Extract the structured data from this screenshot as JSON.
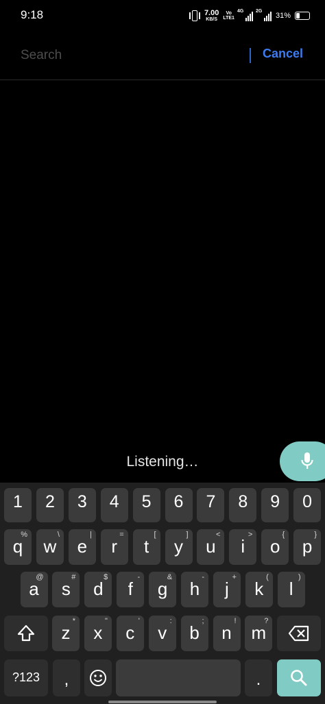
{
  "status_bar": {
    "time": "9:18",
    "net_speed_value": "7.00",
    "net_speed_unit": "KB/S",
    "volte_top": "Vo",
    "volte_bottom": "LTE1",
    "sig1_label": "4G",
    "sig2_label": "2G",
    "battery_pct": "31%",
    "battery_level": 0.31
  },
  "search": {
    "placeholder": "Search",
    "value": "",
    "cancel_label": "Cancel"
  },
  "voice": {
    "status": "Listening…"
  },
  "keyboard": {
    "numbers": [
      "1",
      "2",
      "3",
      "4",
      "5",
      "6",
      "7",
      "8",
      "9",
      "0"
    ],
    "row1": [
      {
        "key": "q",
        "hint": "%"
      },
      {
        "key": "w",
        "hint": "\\"
      },
      {
        "key": "e",
        "hint": "|"
      },
      {
        "key": "r",
        "hint": "="
      },
      {
        "key": "t",
        "hint": "["
      },
      {
        "key": "y",
        "hint": "]"
      },
      {
        "key": "u",
        "hint": "<"
      },
      {
        "key": "i",
        "hint": ">"
      },
      {
        "key": "o",
        "hint": "{"
      },
      {
        "key": "p",
        "hint": "}"
      }
    ],
    "row2": [
      {
        "key": "a",
        "hint": "@"
      },
      {
        "key": "s",
        "hint": "#"
      },
      {
        "key": "d",
        "hint": "$"
      },
      {
        "key": "f",
        "hint": "-"
      },
      {
        "key": "g",
        "hint": "&"
      },
      {
        "key": "h",
        "hint": "-"
      },
      {
        "key": "j",
        "hint": "+"
      },
      {
        "key": "k",
        "hint": "("
      },
      {
        "key": "l",
        "hint": ")"
      }
    ],
    "row3": [
      {
        "key": "z",
        "hint": "*"
      },
      {
        "key": "x",
        "hint": "\""
      },
      {
        "key": "c",
        "hint": "'"
      },
      {
        "key": "v",
        "hint": ":"
      },
      {
        "key": "b",
        "hint": ";"
      },
      {
        "key": "n",
        "hint": "!"
      },
      {
        "key": "m",
        "hint": "?"
      }
    ],
    "symbols_label": "?123",
    "comma_label": ",",
    "period_label": ".",
    "colors": {
      "background": "#202020",
      "key": "#3b3b3b",
      "accent": "#80cbc4",
      "link": "#3d7cf0"
    }
  }
}
